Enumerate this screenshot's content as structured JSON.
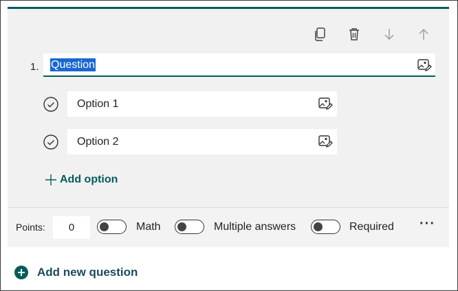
{
  "question": {
    "number": "1.",
    "text": "Question",
    "toolbar": [
      "copy-icon",
      "delete-icon",
      "move-down-icon",
      "move-up-icon"
    ]
  },
  "options": [
    {
      "label": "Option 1"
    },
    {
      "label": "Option 2"
    }
  ],
  "add_option_label": "Add option",
  "footer": {
    "points_label": "Points:",
    "points_value": "0",
    "toggles": [
      {
        "label": "Math",
        "on": false
      },
      {
        "label": "Multiple answers",
        "on": false
      },
      {
        "label": "Required",
        "on": false
      }
    ],
    "more_label": "···"
  },
  "add_question_label": "Add new question",
  "colors": {
    "accent": "#045c5b",
    "selection": "#1967d2",
    "card_bg": "#f1f1f1"
  }
}
